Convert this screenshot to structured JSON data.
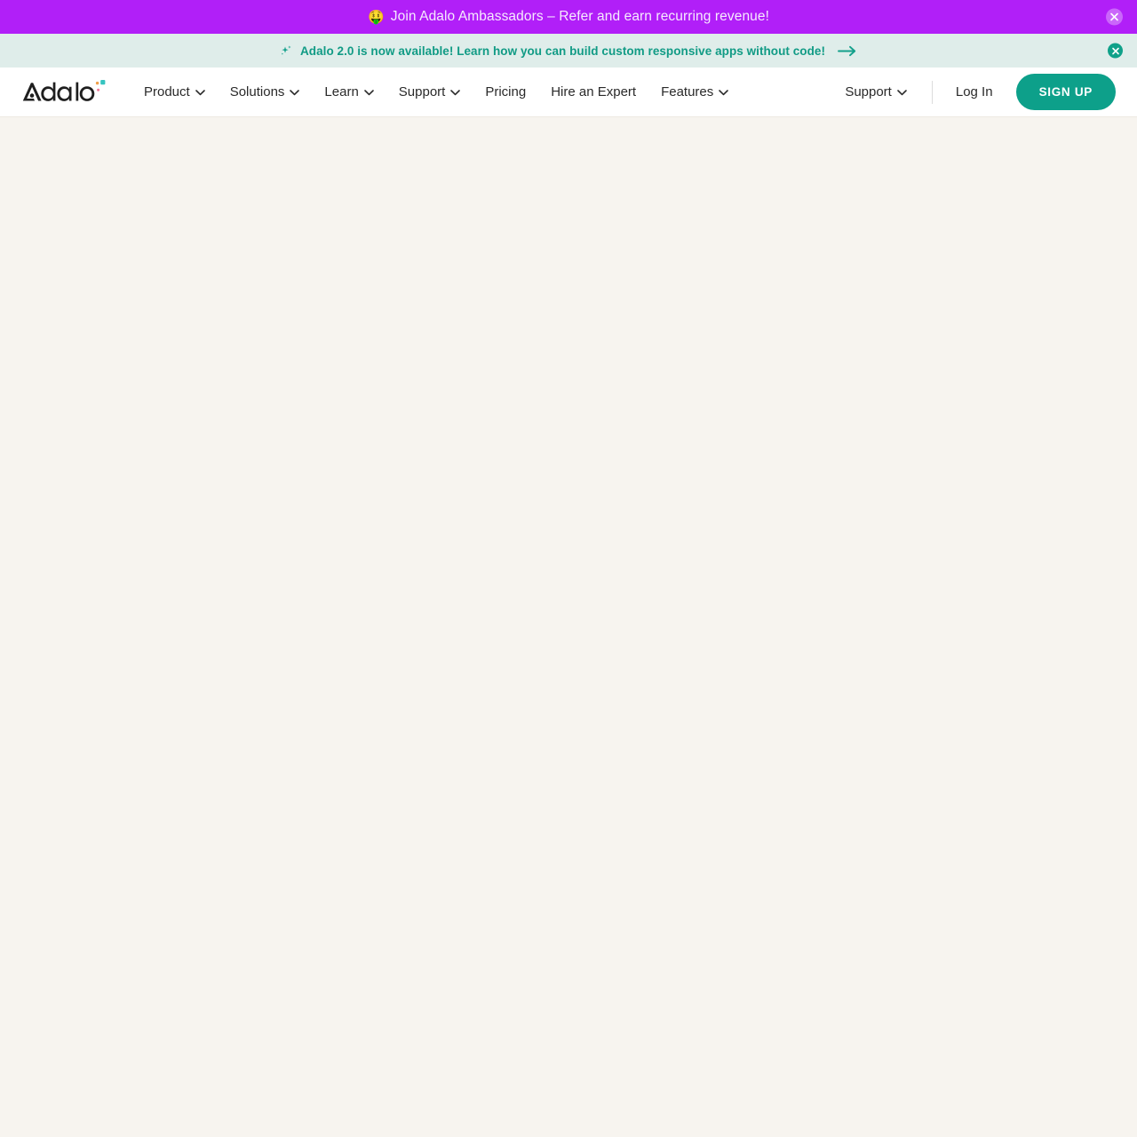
{
  "promo_banner": {
    "emoji": "🤑",
    "emoji_name": "money-mouth-face-emoji",
    "text": "Join Adalo Ambassadors – Refer and earn recurring revenue!",
    "background_color": "#B11FF8",
    "text_color": "#F6EAFE",
    "close_label": "×"
  },
  "announce_banner": {
    "icon_name": "sparkles-icon",
    "text": "Adalo 2.0 is now available! Learn how you can build custom responsive apps without code!",
    "arrow_name": "arrow-right-icon",
    "background_color": "#DFEDEA",
    "text_color": "#119B85",
    "close_label": "×"
  },
  "navbar": {
    "logo_text": "Adalo",
    "left_items": [
      {
        "label": "Product",
        "has_chevron": true
      },
      {
        "label": "Solutions",
        "has_chevron": true
      },
      {
        "label": "Learn",
        "has_chevron": true
      },
      {
        "label": "Support",
        "has_chevron": true
      },
      {
        "label": "Pricing",
        "has_chevron": false
      },
      {
        "label": "Hire an Expert",
        "has_chevron": false
      },
      {
        "label": "Features",
        "has_chevron": true
      }
    ],
    "right": {
      "support_label": "Support",
      "login_label": "Log In",
      "signup_label": "SIGN UP",
      "signup_color": "#0DA08A"
    }
  },
  "page": {
    "background_color": "#F7F4EF",
    "content": ""
  }
}
